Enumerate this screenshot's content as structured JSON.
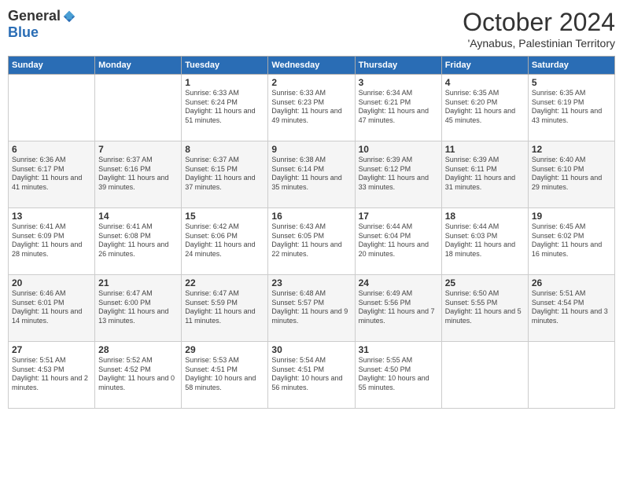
{
  "header": {
    "logo": {
      "general": "General",
      "blue": "Blue"
    },
    "month": "October 2024",
    "location": "'Aynabus, Palestinian Territory"
  },
  "days_of_week": [
    "Sunday",
    "Monday",
    "Tuesday",
    "Wednesday",
    "Thursday",
    "Friday",
    "Saturday"
  ],
  "weeks": [
    [
      {
        "day": "",
        "info": ""
      },
      {
        "day": "",
        "info": ""
      },
      {
        "day": "1",
        "info": "Sunrise: 6:33 AM\nSunset: 6:24 PM\nDaylight: 11 hours and 51 minutes."
      },
      {
        "day": "2",
        "info": "Sunrise: 6:33 AM\nSunset: 6:23 PM\nDaylight: 11 hours and 49 minutes."
      },
      {
        "day": "3",
        "info": "Sunrise: 6:34 AM\nSunset: 6:21 PM\nDaylight: 11 hours and 47 minutes."
      },
      {
        "day": "4",
        "info": "Sunrise: 6:35 AM\nSunset: 6:20 PM\nDaylight: 11 hours and 45 minutes."
      },
      {
        "day": "5",
        "info": "Sunrise: 6:35 AM\nSunset: 6:19 PM\nDaylight: 11 hours and 43 minutes."
      }
    ],
    [
      {
        "day": "6",
        "info": "Sunrise: 6:36 AM\nSunset: 6:17 PM\nDaylight: 11 hours and 41 minutes."
      },
      {
        "day": "7",
        "info": "Sunrise: 6:37 AM\nSunset: 6:16 PM\nDaylight: 11 hours and 39 minutes."
      },
      {
        "day": "8",
        "info": "Sunrise: 6:37 AM\nSunset: 6:15 PM\nDaylight: 11 hours and 37 minutes."
      },
      {
        "day": "9",
        "info": "Sunrise: 6:38 AM\nSunset: 6:14 PM\nDaylight: 11 hours and 35 minutes."
      },
      {
        "day": "10",
        "info": "Sunrise: 6:39 AM\nSunset: 6:12 PM\nDaylight: 11 hours and 33 minutes."
      },
      {
        "day": "11",
        "info": "Sunrise: 6:39 AM\nSunset: 6:11 PM\nDaylight: 11 hours and 31 minutes."
      },
      {
        "day": "12",
        "info": "Sunrise: 6:40 AM\nSunset: 6:10 PM\nDaylight: 11 hours and 29 minutes."
      }
    ],
    [
      {
        "day": "13",
        "info": "Sunrise: 6:41 AM\nSunset: 6:09 PM\nDaylight: 11 hours and 28 minutes."
      },
      {
        "day": "14",
        "info": "Sunrise: 6:41 AM\nSunset: 6:08 PM\nDaylight: 11 hours and 26 minutes."
      },
      {
        "day": "15",
        "info": "Sunrise: 6:42 AM\nSunset: 6:06 PM\nDaylight: 11 hours and 24 minutes."
      },
      {
        "day": "16",
        "info": "Sunrise: 6:43 AM\nSunset: 6:05 PM\nDaylight: 11 hours and 22 minutes."
      },
      {
        "day": "17",
        "info": "Sunrise: 6:44 AM\nSunset: 6:04 PM\nDaylight: 11 hours and 20 minutes."
      },
      {
        "day": "18",
        "info": "Sunrise: 6:44 AM\nSunset: 6:03 PM\nDaylight: 11 hours and 18 minutes."
      },
      {
        "day": "19",
        "info": "Sunrise: 6:45 AM\nSunset: 6:02 PM\nDaylight: 11 hours and 16 minutes."
      }
    ],
    [
      {
        "day": "20",
        "info": "Sunrise: 6:46 AM\nSunset: 6:01 PM\nDaylight: 11 hours and 14 minutes."
      },
      {
        "day": "21",
        "info": "Sunrise: 6:47 AM\nSunset: 6:00 PM\nDaylight: 11 hours and 13 minutes."
      },
      {
        "day": "22",
        "info": "Sunrise: 6:47 AM\nSunset: 5:59 PM\nDaylight: 11 hours and 11 minutes."
      },
      {
        "day": "23",
        "info": "Sunrise: 6:48 AM\nSunset: 5:57 PM\nDaylight: 11 hours and 9 minutes."
      },
      {
        "day": "24",
        "info": "Sunrise: 6:49 AM\nSunset: 5:56 PM\nDaylight: 11 hours and 7 minutes."
      },
      {
        "day": "25",
        "info": "Sunrise: 6:50 AM\nSunset: 5:55 PM\nDaylight: 11 hours and 5 minutes."
      },
      {
        "day": "26",
        "info": "Sunrise: 5:51 AM\nSunset: 4:54 PM\nDaylight: 11 hours and 3 minutes."
      }
    ],
    [
      {
        "day": "27",
        "info": "Sunrise: 5:51 AM\nSunset: 4:53 PM\nDaylight: 11 hours and 2 minutes."
      },
      {
        "day": "28",
        "info": "Sunrise: 5:52 AM\nSunset: 4:52 PM\nDaylight: 11 hours and 0 minutes."
      },
      {
        "day": "29",
        "info": "Sunrise: 5:53 AM\nSunset: 4:51 PM\nDaylight: 10 hours and 58 minutes."
      },
      {
        "day": "30",
        "info": "Sunrise: 5:54 AM\nSunset: 4:51 PM\nDaylight: 10 hours and 56 minutes."
      },
      {
        "day": "31",
        "info": "Sunrise: 5:55 AM\nSunset: 4:50 PM\nDaylight: 10 hours and 55 minutes."
      },
      {
        "day": "",
        "info": ""
      },
      {
        "day": "",
        "info": ""
      }
    ]
  ]
}
